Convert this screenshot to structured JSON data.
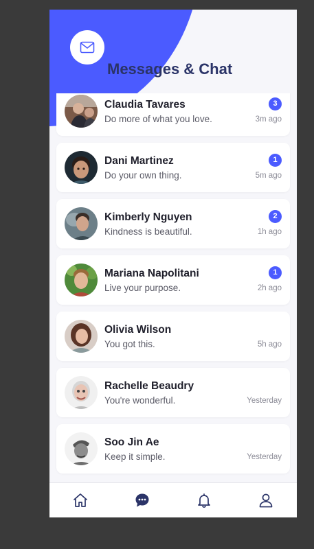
{
  "header": {
    "title": "Messages & Chat",
    "mail_icon": "envelope-icon"
  },
  "colors": {
    "accent": "#4b5bff",
    "title": "#2b3468",
    "background": "#f6f6fa",
    "nav_icon": "#2b3468"
  },
  "chats": [
    {
      "name": "Claudia Tavares",
      "message": "Do more of what you love.",
      "time": "3m ago",
      "unread": "3"
    },
    {
      "name": "Dani Martinez",
      "message": "Do your own thing.",
      "time": "5m ago",
      "unread": "1"
    },
    {
      "name": "Kimberly Nguyen",
      "message": "Kindness is beautiful.",
      "time": "1h ago",
      "unread": "2"
    },
    {
      "name": "Mariana Napolitani",
      "message": "Live your purpose.",
      "time": "2h ago",
      "unread": "1"
    },
    {
      "name": "Olivia Wilson",
      "message": "You got this.",
      "time": "5h ago",
      "unread": ""
    },
    {
      "name": "Rachelle Beaudry",
      "message": "You're wonderful.",
      "time": "Yesterday",
      "unread": ""
    },
    {
      "name": "Soo Jin Ae",
      "message": "Keep it simple.",
      "time": "Yesterday",
      "unread": ""
    }
  ],
  "nav": {
    "items": [
      {
        "icon": "home-icon",
        "active": false
      },
      {
        "icon": "chat-bubble-icon",
        "active": true
      },
      {
        "icon": "bell-icon",
        "active": false
      },
      {
        "icon": "user-icon",
        "active": false
      }
    ]
  }
}
